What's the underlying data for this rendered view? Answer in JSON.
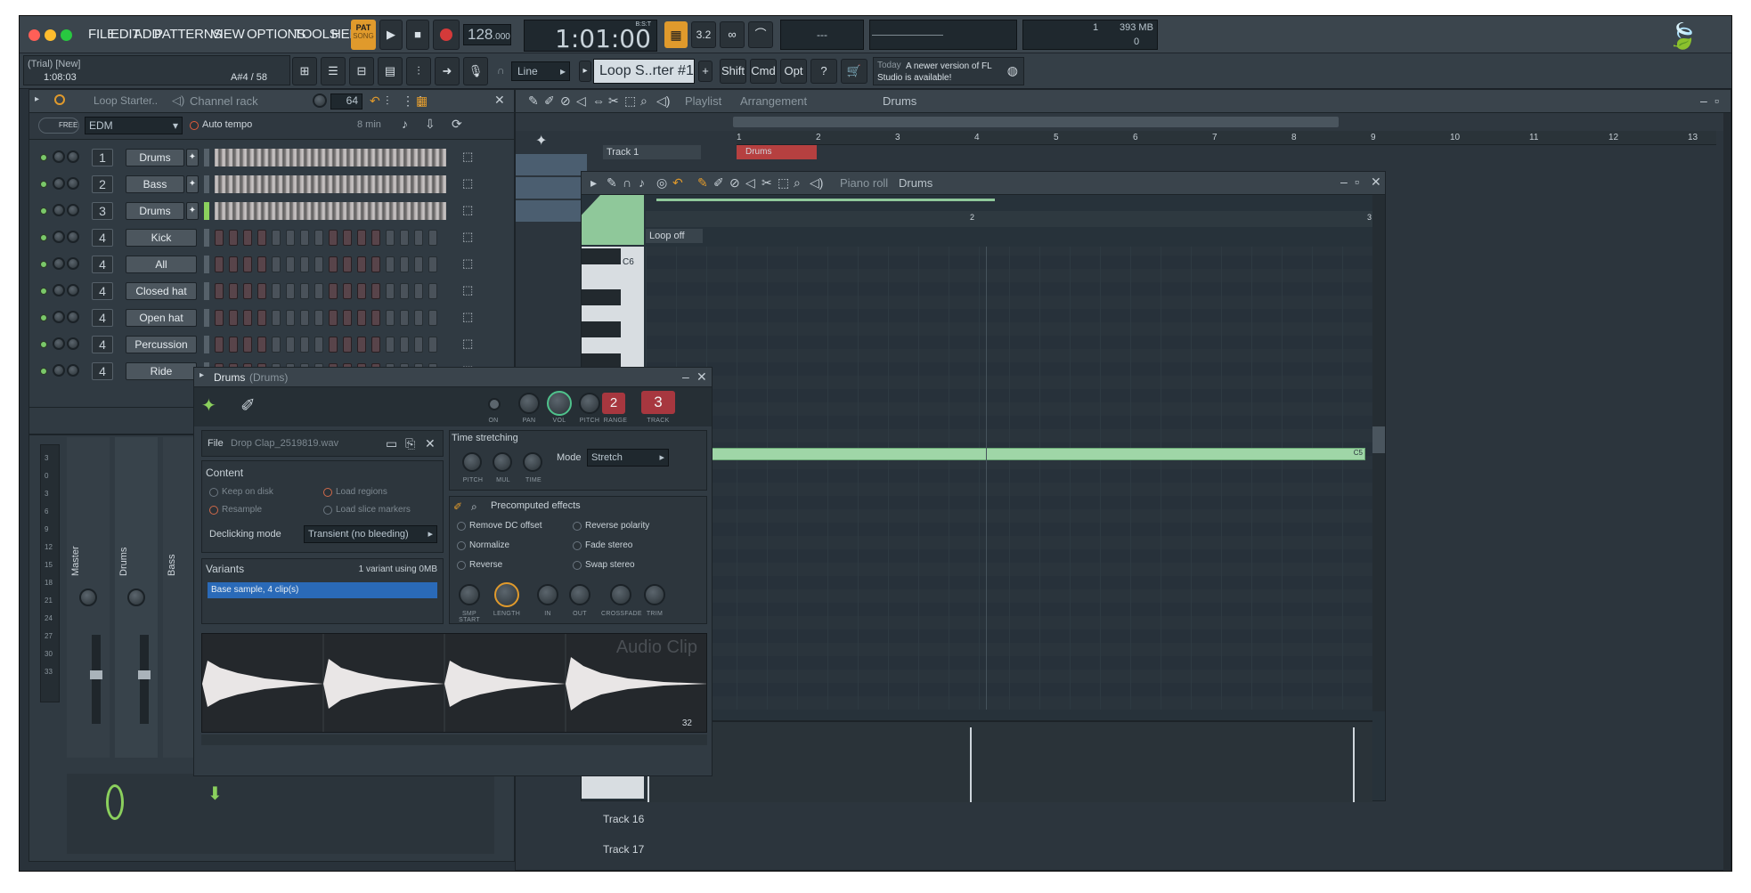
{
  "menu": {
    "items": [
      "FILE",
      "EDIT",
      "ADD",
      "PATTERNS",
      "VIEW",
      "OPTIONS",
      "TOOLS",
      "HELP"
    ]
  },
  "transport": {
    "pat": "PAT",
    "song": "SONG",
    "tempo": "128",
    "tempo_dec": ".000",
    "time": "1:01:00",
    "time_small": "B:S:T",
    "bars_label": "3.2",
    "dash": "---"
  },
  "status": {
    "trial": "(Trial) [New]",
    "time": "1:08:03",
    "note": "A#4 / 58",
    "mem": "393 MB",
    "mem_small": "1",
    "zero": "0"
  },
  "toolbar2": {
    "mode": "Line",
    "pattern": "Loop S..rter #1",
    "shift": "Shift",
    "cmd": "Cmd",
    "opt": "Opt",
    "news_today": "Today",
    "news_text": "A newer version of FL Studio is available!"
  },
  "channel_rack": {
    "title": "Channel rack",
    "loop_starter": "Loop Starter..",
    "swing": "64",
    "genre": "EDM",
    "free": "FREE",
    "auto_tempo": "Auto tempo",
    "duration": "8 min",
    "channels": [
      {
        "num": "1",
        "name": "Drums"
      },
      {
        "num": "2",
        "name": "Bass"
      },
      {
        "num": "3",
        "name": "Drums"
      },
      {
        "num": "4",
        "name": "Kick"
      },
      {
        "num": "4",
        "name": "All"
      },
      {
        "num": "4",
        "name": "Closed hat"
      },
      {
        "num": "4",
        "name": "Open hat"
      },
      {
        "num": "4",
        "name": "Percussion"
      },
      {
        "num": "4",
        "name": "Ride"
      }
    ],
    "add": "+"
  },
  "mixer": {
    "scale": [
      "3",
      "0",
      "3",
      "6",
      "9",
      "12",
      "15",
      "18",
      "21",
      "24",
      "27",
      "30",
      "33"
    ],
    "tracks": [
      "Master",
      "Drums",
      "Bass"
    ]
  },
  "playlist": {
    "title": "Playlist",
    "path1": "Arrangement",
    "path2": "Drums",
    "track1": "Track 1",
    "drums_clip": "Drums",
    "ruler": [
      "1",
      "2",
      "3",
      "4",
      "5",
      "6",
      "7",
      "8",
      "9",
      "10",
      "11",
      "12",
      "13"
    ],
    "track16": "Track 16",
    "track17": "Track 17"
  },
  "piano_roll": {
    "title": "Piano roll",
    "path": "Drums",
    "ruler": [
      "2",
      "3"
    ],
    "loop": "Loop off",
    "c6": "C6",
    "note_label": "C5"
  },
  "sampler": {
    "title": "Drums",
    "subtitle": "(Drums)",
    "knobs": [
      "ON",
      "PAN",
      "VOL",
      "PITCH",
      "RANGE",
      "TRACK"
    ],
    "range": "2",
    "track": "3",
    "file_label": "File",
    "file_name": "Drop Clap_2519819.wav",
    "content": "Content",
    "keep_on_disk": "Keep on disk",
    "load_regions": "Load regions",
    "resample": "Resample",
    "load_slice": "Load slice markers",
    "declick_label": "Declicking mode",
    "declick_value": "Transient (no bleeding)",
    "variants": "Variants",
    "variants_info": "1 variant using 0MB",
    "variant_item": "Base sample, 4 clip(s)",
    "time_stretching": "Time stretching",
    "ts_knobs": [
      "PITCH",
      "MUL",
      "TIME"
    ],
    "mode_label": "Mode",
    "mode_value": "Stretch",
    "precomputed": "Precomputed effects",
    "effects": [
      "Remove DC offset",
      "Reverse polarity",
      "Normalize",
      "Fade stereo",
      "Reverse",
      "Swap stereo"
    ],
    "bottom_knobs": [
      "SMP START",
      "LENGTH",
      "IN",
      "OUT",
      "CROSSFADE",
      "TRIM"
    ],
    "audio_clip": "Audio Clip",
    "zoom": "32"
  }
}
